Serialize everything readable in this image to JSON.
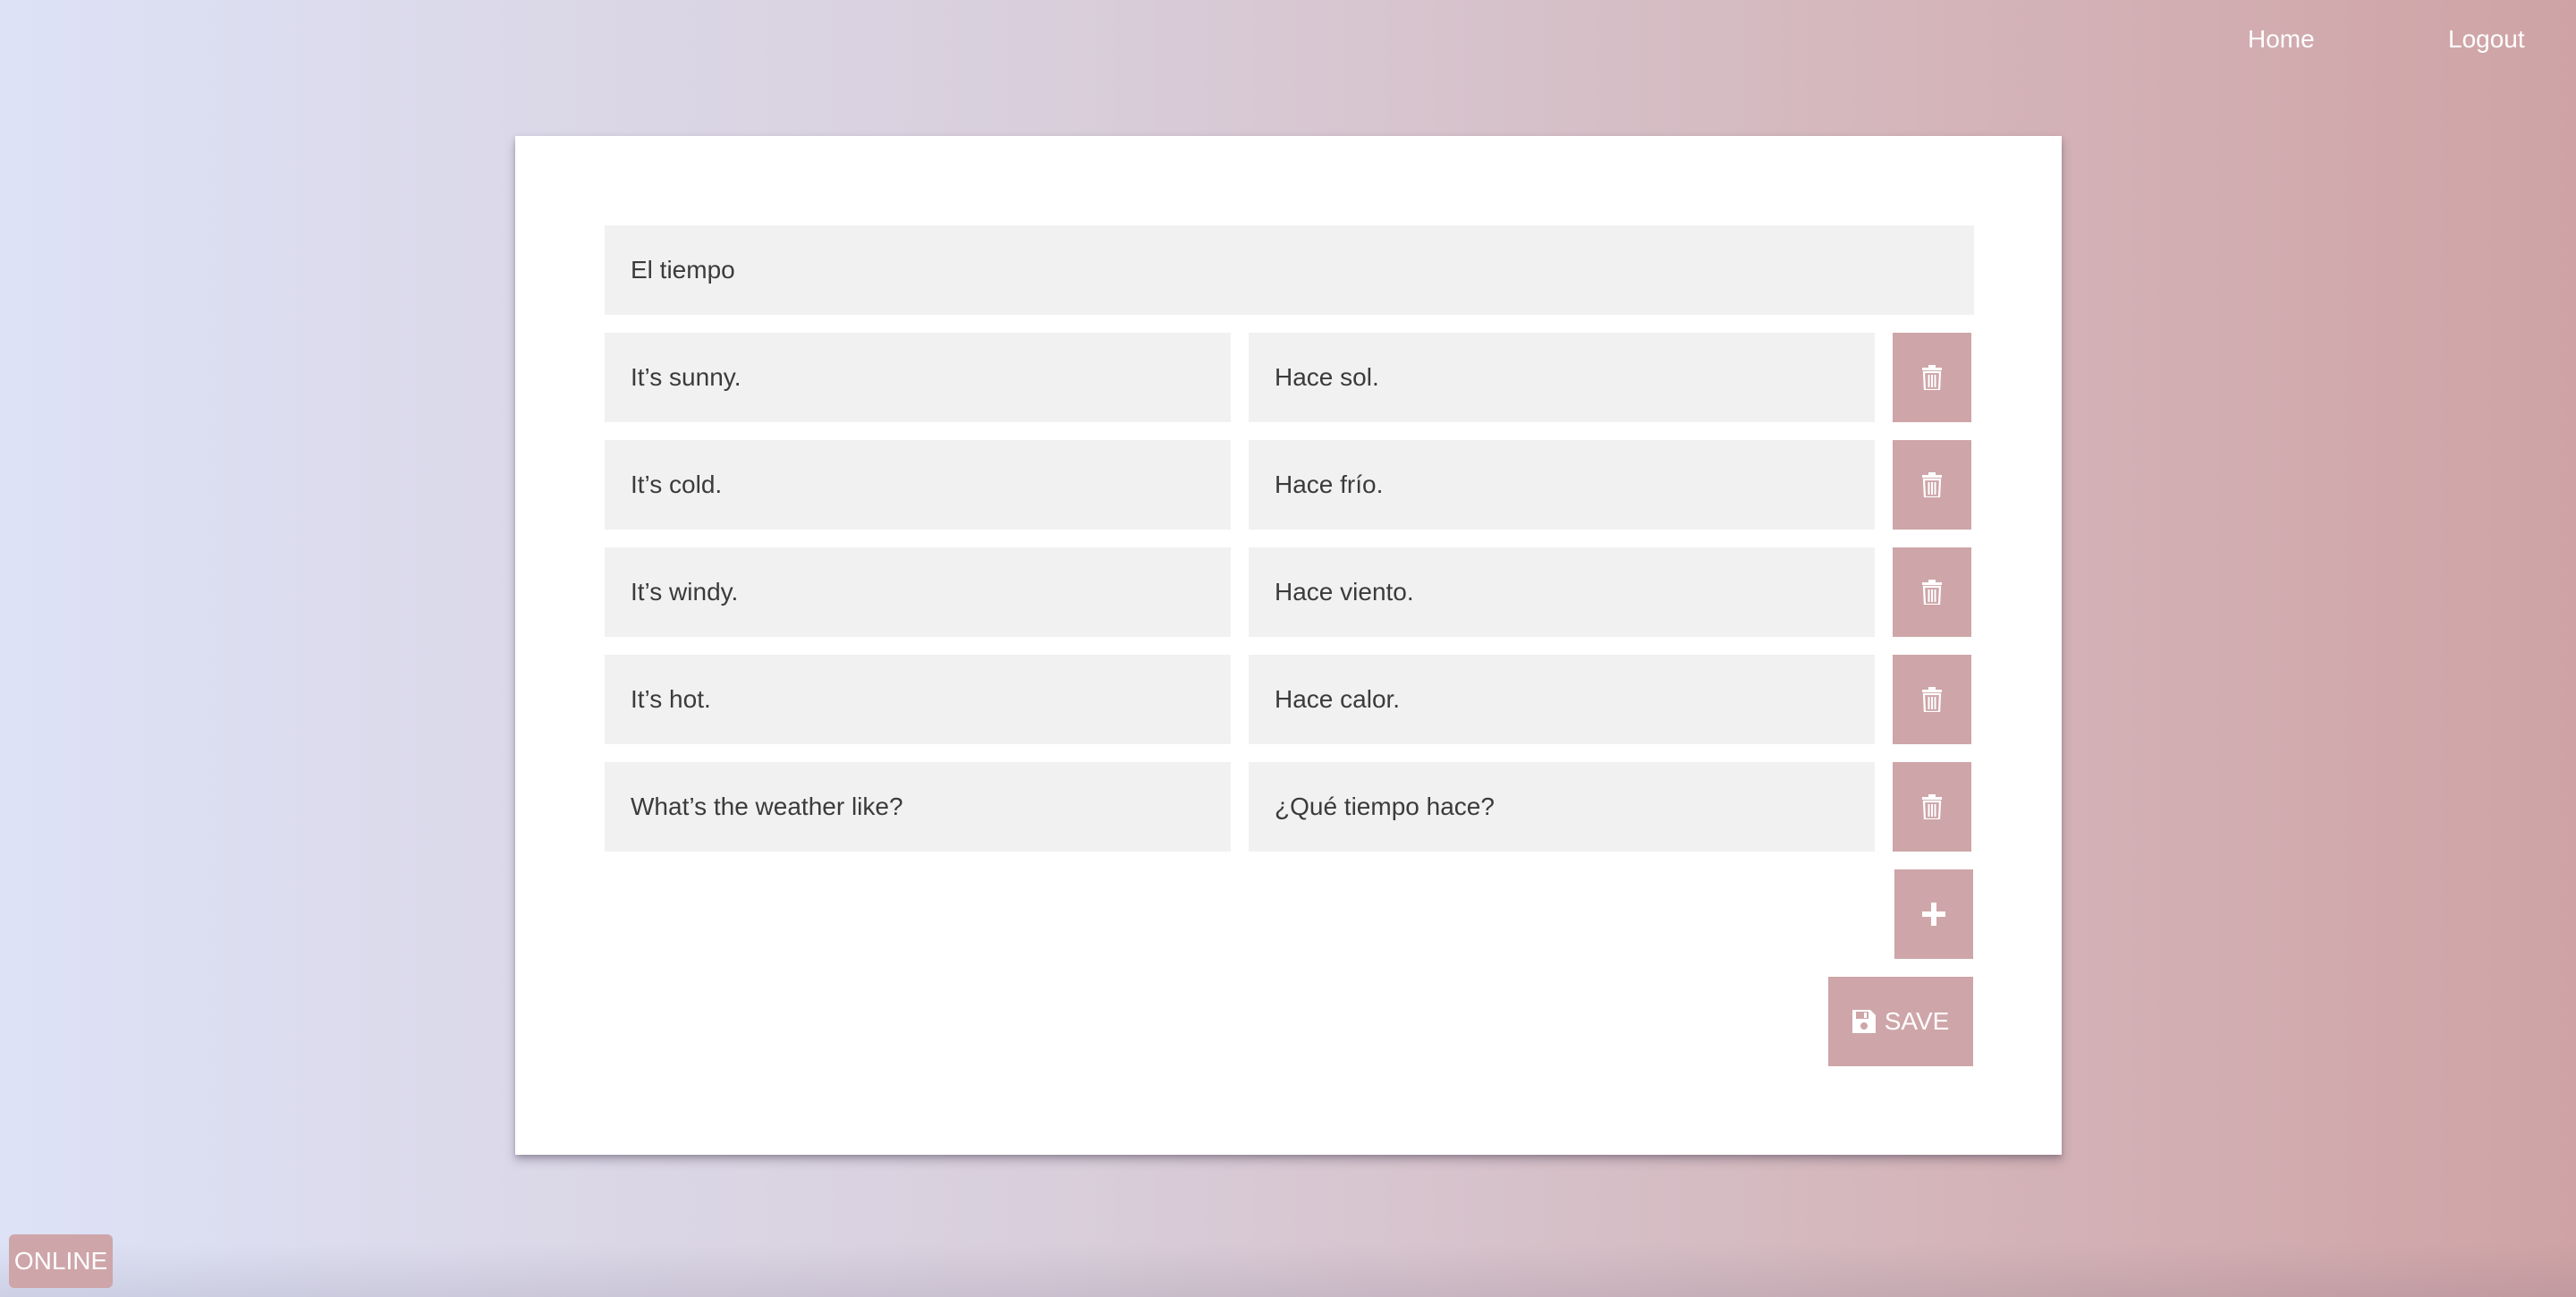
{
  "nav": {
    "home_label": "Home",
    "logout_label": "Logout"
  },
  "deck": {
    "title": "El tiempo",
    "cards": [
      {
        "english": "It’s sunny.",
        "spanish": "Hace sol."
      },
      {
        "english": "It’s cold.",
        "spanish": "Hace frío."
      },
      {
        "english": "It’s windy.",
        "spanish": "Hace viento."
      },
      {
        "english": "It’s hot.",
        "spanish": "Hace calor."
      },
      {
        "english": "What’s the weather like?",
        "spanish": "¿Qué tiempo hace?"
      }
    ],
    "delete_icon": "trash-icon",
    "add_icon": "plus-icon",
    "save_icon": "floppy-disk-icon",
    "save_label": "SAVE"
  },
  "status": {
    "label": "ONLINE"
  },
  "colors": {
    "accent": "#cea5a8",
    "field_bg": "#f1f1f1",
    "text": "#3b3b3b"
  }
}
